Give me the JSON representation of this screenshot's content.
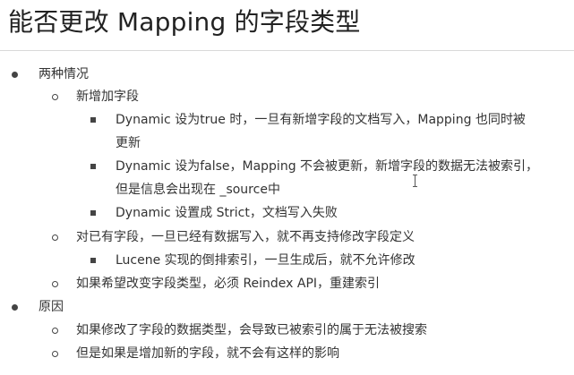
{
  "title": "能否更改 Mapping 的字段类型",
  "items": [
    {
      "text": "两种情况"
    },
    {
      "text": "新增加字段"
    },
    {
      "text": "Dynamic 设为true 时，一旦有新增字段的文档写入，Mapping 也同时被"
    },
    {
      "text": "更新"
    },
    {
      "text": "Dynamic 设为false，Mapping 不会被更新，新增字段的数据无法被索引，"
    },
    {
      "text": "但是信息会出现在 _source中"
    },
    {
      "text": "Dynamic 设置成 Strict，文档写入失败"
    },
    {
      "text": "对已有字段，一旦已经有数据写入，就不再支持修改字段定义"
    },
    {
      "text": "Lucene 实现的倒排索引，一旦生成后，就不允许修改"
    },
    {
      "text": "如果希望改变字段类型，必须 Reindex API，重建索引"
    },
    {
      "text": "原因"
    },
    {
      "text": "如果修改了字段的数据类型，会导致已被索引的属于无法被搜索"
    },
    {
      "text": "但是如果是增加新的字段，就不会有这样的影响"
    }
  ]
}
